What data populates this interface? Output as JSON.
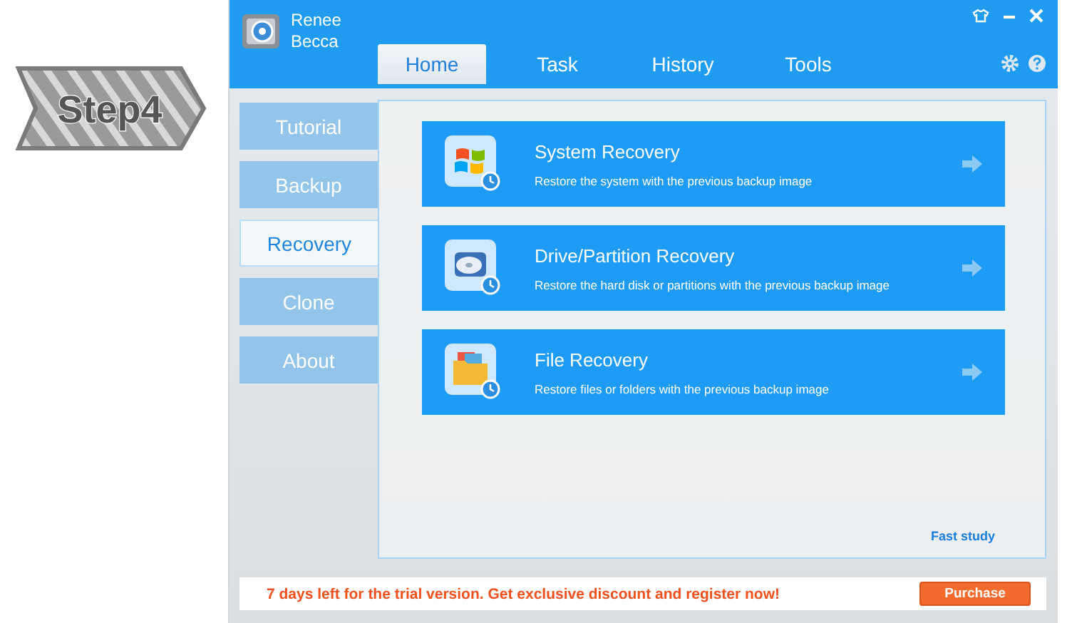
{
  "step_badge": "Step4",
  "app": {
    "title": "Renee Becca",
    "tabs": [
      {
        "label": "Home",
        "selected": true
      },
      {
        "label": "Task",
        "selected": false
      },
      {
        "label": "History",
        "selected": false
      },
      {
        "label": "Tools",
        "selected": false
      }
    ],
    "sidebar": {
      "items": [
        {
          "label": "Tutorial",
          "selected": false
        },
        {
          "label": "Backup",
          "selected": false
        },
        {
          "label": "Recovery",
          "selected": true
        },
        {
          "label": "Clone",
          "selected": false
        },
        {
          "label": "About",
          "selected": false
        }
      ]
    },
    "actions": [
      {
        "kind": "system",
        "title": "System Recovery",
        "description": "Restore the system with the previous backup image"
      },
      {
        "kind": "drive",
        "title": "Drive/Partition Recovery",
        "description": "Restore the hard disk or partitions with the previous backup image"
      },
      {
        "kind": "file",
        "title": "File Recovery",
        "description": "Restore files or folders with the previous backup image"
      }
    ],
    "link": "Fast study",
    "trial_bar": {
      "message": "7 days left for the trial version. Get exclusive discount and register now!",
      "button": "Purchase"
    }
  }
}
